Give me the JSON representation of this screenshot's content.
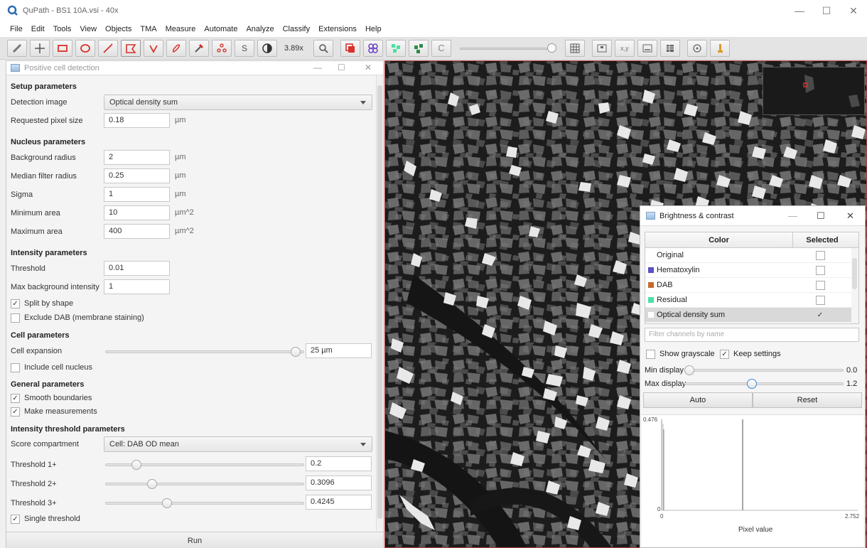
{
  "window": {
    "title": "QuPath - BS1 10A.vsi - 40x",
    "controls": [
      "—",
      "☐",
      "✕"
    ]
  },
  "menubar": [
    "File",
    "Edit",
    "Tools",
    "View",
    "Objects",
    "TMA",
    "Measure",
    "Automate",
    "Analyze",
    "Classify",
    "Extensions",
    "Help"
  ],
  "toolbar": {
    "zoom": "3.89x",
    "text_tool_label": "S"
  },
  "pcd": {
    "title": "Positive cell detection",
    "controls": [
      "—",
      "☐",
      "✕"
    ],
    "setup": {
      "heading": "Setup parameters",
      "detection_image_label": "Detection image",
      "detection_image_value": "Optical density sum",
      "pixel_size_label": "Requested pixel size",
      "pixel_size_value": "0.18",
      "pixel_size_unit": "µm"
    },
    "nucleus": {
      "heading": "Nucleus parameters",
      "bg_radius_label": "Background radius",
      "bg_radius_value": "2",
      "bg_radius_unit": "µm",
      "median_label": "Median filter radius",
      "median_value": "0.25",
      "median_unit": "µm",
      "sigma_label": "Sigma",
      "sigma_value": "1",
      "sigma_unit": "µm",
      "min_area_label": "Minimum area",
      "min_area_value": "10",
      "min_area_unit": "µm^2",
      "max_area_label": "Maximum area",
      "max_area_value": "400",
      "max_area_unit": "µm^2"
    },
    "intensity": {
      "heading": "Intensity parameters",
      "threshold_label": "Threshold",
      "threshold_value": "0.01",
      "max_bg_label": "Max background intensity",
      "max_bg_value": "1",
      "split_label": "Split by shape",
      "split_checked": true,
      "exclude_label": "Exclude DAB (membrane staining)",
      "exclude_checked": false
    },
    "cell": {
      "heading": "Cell parameters",
      "expansion_label": "Cell expansion",
      "expansion_value": "25 µm",
      "expansion_fraction": 0.98,
      "include_nucleus_label": "Include cell nucleus",
      "include_nucleus_checked": false
    },
    "general": {
      "heading": "General parameters",
      "smooth_label": "Smooth boundaries",
      "smooth_checked": true,
      "measure_label": "Make measurements",
      "measure_checked": true
    },
    "threshold": {
      "heading": "Intensity threshold parameters",
      "score_label": "Score compartment",
      "score_value": "Cell: DAB OD mean",
      "t1_label": "Threshold 1+",
      "t1_value": "0.2",
      "t1_fraction": 0.14,
      "t2_label": "Threshold 2+",
      "t2_value": "0.3096",
      "t2_fraction": 0.22,
      "t3_label": "Threshold 3+",
      "t3_value": "0.4245",
      "t3_fraction": 0.3,
      "single_label": "Single threshold",
      "single_checked": true
    },
    "run_label": "Run"
  },
  "bc": {
    "title": "Brightness & contrast",
    "controls": [
      "—",
      "☐",
      "✕"
    ],
    "col_color": "Color",
    "col_selected": "Selected",
    "channels": [
      {
        "name": "Original",
        "color": "#ffffff",
        "checked": false
      },
      {
        "name": "Hematoxylin",
        "color": "#5b4fc4",
        "checked": false
      },
      {
        "name": "DAB",
        "color": "#c46a2e",
        "checked": false
      },
      {
        "name": "Residual",
        "color": "#4be0a3",
        "checked": false
      },
      {
        "name": "Optical density sum",
        "color": "#ffffff",
        "checked": true
      }
    ],
    "filter_placeholder": "Filter channels by name",
    "show_grayscale": "Show grayscale",
    "show_grayscale_checked": false,
    "keep_settings": "Keep settings",
    "keep_settings_checked": true,
    "min_label": "Min display",
    "min_value": "0.0",
    "min_fraction": 0.0,
    "max_label": "Max display",
    "max_value": "1.2",
    "max_fraction": 0.42,
    "auto_label": "Auto",
    "reset_label": "Reset",
    "hist_ymax": "0.476",
    "hist_y0": "0",
    "hist_x0": "0",
    "hist_xmax": "2.752",
    "hist_xlabel": "Pixel value"
  },
  "colors": {
    "accent_red": "#d9312b",
    "accent_blue": "#2b6cd9",
    "selected_row": "#d9d9d9"
  }
}
